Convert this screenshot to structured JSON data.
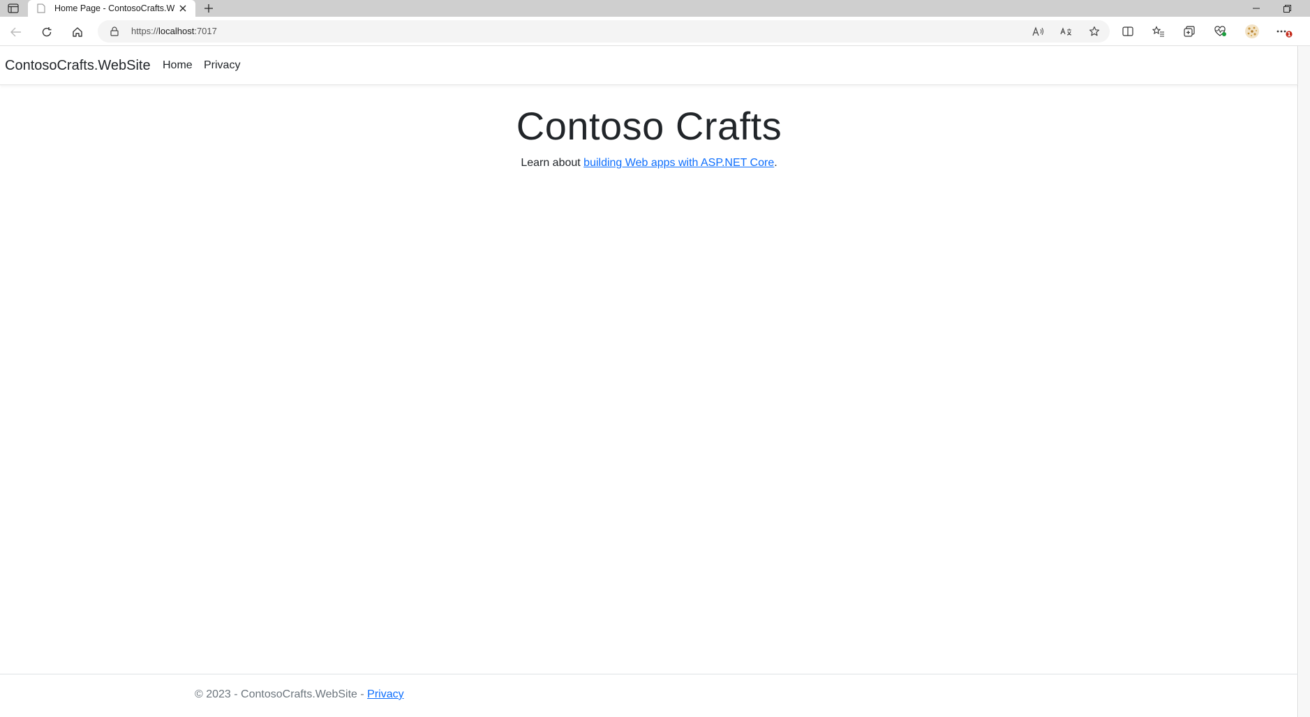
{
  "browser": {
    "tab_title": "Home Page - ContosoCrafts.WebSite",
    "url_prefix": "https://",
    "url_host": "localhost",
    "url_port": ":7017",
    "notification_badge": "1"
  },
  "site": {
    "brand": "ContosoCrafts.WebSite",
    "nav": [
      {
        "label": "Home"
      },
      {
        "label": "Privacy"
      }
    ]
  },
  "hero": {
    "heading": "Contoso Crafts",
    "text_before": "Learn about ",
    "link_text": "building Web apps with ASP.NET Core",
    "text_after": "."
  },
  "footer": {
    "copyright": "© 2023 - ContosoCrafts.WebSite - ",
    "privacy_link": "Privacy"
  },
  "colors": {
    "link": "#0d6efd",
    "text": "#212529",
    "muted": "#6c757d",
    "tabstrip": "#cfcfcf"
  }
}
